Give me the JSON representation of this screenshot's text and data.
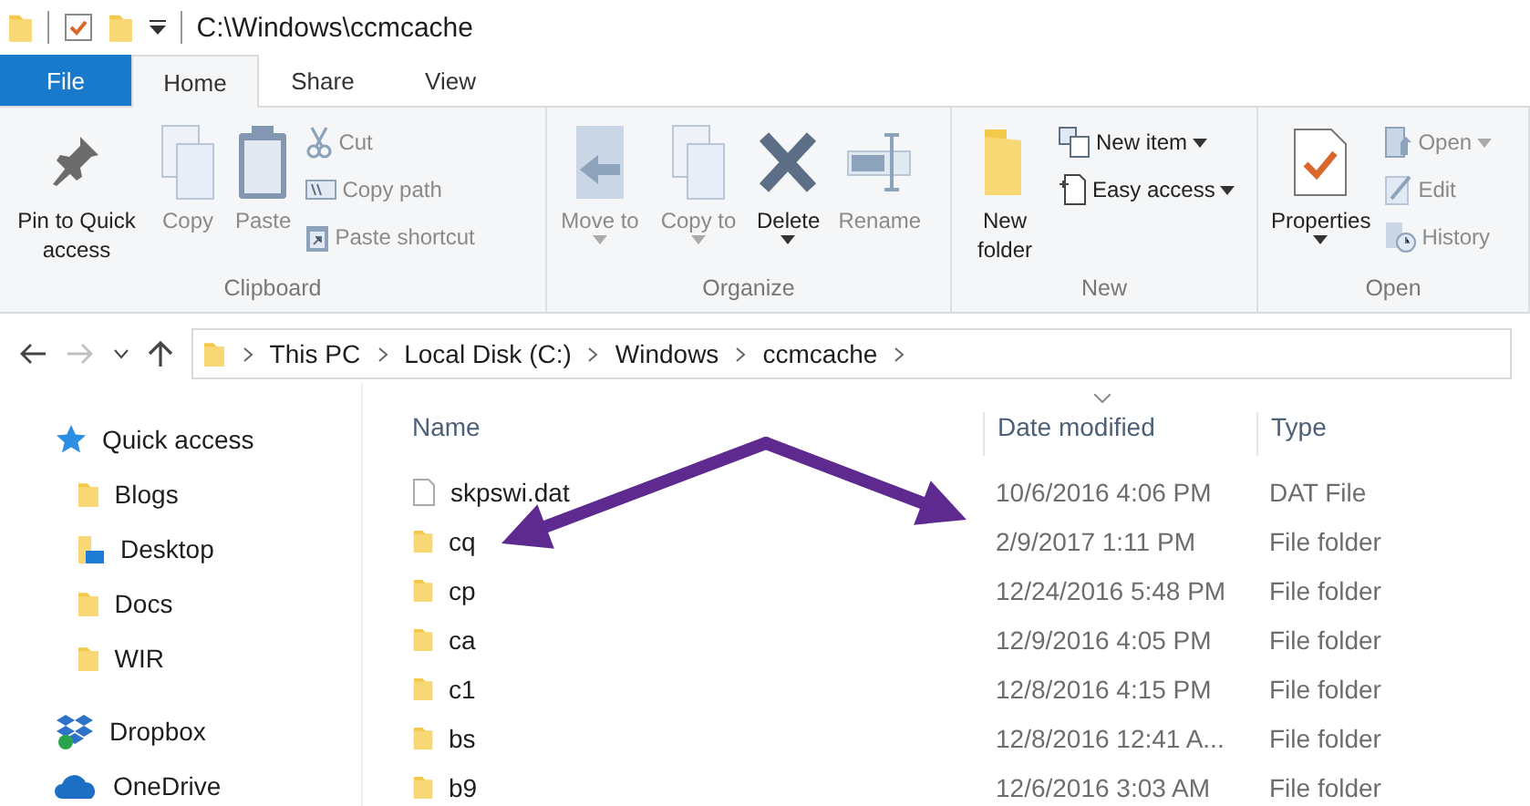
{
  "title_bar": {
    "path": "C:\\Windows\\ccmcache"
  },
  "tabs": [
    {
      "label": "File",
      "kind": "file",
      "selected": false
    },
    {
      "label": "Home",
      "kind": "tab",
      "selected": true
    },
    {
      "label": "Share",
      "kind": "tab",
      "selected": false
    },
    {
      "label": "View",
      "kind": "tab",
      "selected": false
    }
  ],
  "ribbon": [
    {
      "label": "Clipboard",
      "items": [
        {
          "label": "Pin to Quick access",
          "kind": "large",
          "disabled": false
        },
        {
          "label": "Copy",
          "kind": "large",
          "disabled": true
        },
        {
          "label": "Paste",
          "kind": "large",
          "disabled": true
        },
        {
          "label": "Cut",
          "kind": "small",
          "disabled": true
        },
        {
          "label": "Copy path",
          "kind": "small",
          "disabled": true
        },
        {
          "label": "Paste shortcut",
          "kind": "small",
          "disabled": true
        }
      ]
    },
    {
      "label": "Organize",
      "items": [
        {
          "label": "Move to",
          "kind": "large",
          "disabled": true,
          "dropdown": true
        },
        {
          "label": "Copy to",
          "kind": "large",
          "disabled": true,
          "dropdown": true
        },
        {
          "label": "Delete",
          "kind": "large",
          "disabled": false,
          "dropdown": true
        },
        {
          "label": "Rename",
          "kind": "large",
          "disabled": true
        }
      ]
    },
    {
      "label": "New",
      "items": [
        {
          "label": "New folder",
          "kind": "large",
          "disabled": false
        },
        {
          "label": "New item",
          "kind": "small",
          "disabled": false,
          "dropdown": true
        },
        {
          "label": "Easy access",
          "kind": "small",
          "disabled": false,
          "dropdown": true
        }
      ]
    },
    {
      "label": "Open",
      "items": [
        {
          "label": "Properties",
          "kind": "large",
          "disabled": false,
          "dropdown": true
        },
        {
          "label": "Open",
          "kind": "small",
          "disabled": true,
          "dropdown": true
        },
        {
          "label": "Edit",
          "kind": "small",
          "disabled": true
        },
        {
          "label": "History",
          "kind": "small",
          "disabled": true
        }
      ]
    }
  ],
  "navigation": {
    "back_disabled": false,
    "forward_disabled": true,
    "breadcrumb": [
      "This PC",
      "Local Disk (C:)",
      "Windows",
      "ccmcache"
    ]
  },
  "sidebar": [
    {
      "label": "Quick access",
      "kind": "star",
      "children": [
        {
          "label": "Blogs",
          "kind": "folder"
        },
        {
          "label": "Desktop",
          "kind": "desktop"
        },
        {
          "label": "Docs",
          "kind": "folder"
        },
        {
          "label": "WIR",
          "kind": "folder"
        }
      ]
    },
    {
      "label": "Dropbox",
      "kind": "dropbox"
    },
    {
      "label": "OneDrive",
      "kind": "cloud"
    }
  ],
  "table": {
    "columns": [
      {
        "label": "Name",
        "sorted": false
      },
      {
        "label": "Date modified",
        "sorted": true
      },
      {
        "label": "Type",
        "sorted": false
      }
    ],
    "rows": [
      {
        "name": "skpswi.dat",
        "date": "10/6/2016 4:06 PM",
        "type": "DAT File",
        "kind": "file"
      },
      {
        "name": "cq",
        "date": "2/9/2017 1:11 PM",
        "type": "File folder",
        "kind": "folder"
      },
      {
        "name": "cp",
        "date": "12/24/2016 5:48 PM",
        "type": "File folder",
        "kind": "folder"
      },
      {
        "name": "ca",
        "date": "12/9/2016 4:05 PM",
        "type": "File folder",
        "kind": "folder"
      },
      {
        "name": "c1",
        "date": "12/8/2016 4:15 PM",
        "type": "File folder",
        "kind": "folder"
      },
      {
        "name": "bs",
        "date": "12/8/2016 12:41 A...",
        "type": "File folder",
        "kind": "folder"
      },
      {
        "name": "b9",
        "date": "12/6/2016 3:03 AM",
        "type": "File folder",
        "kind": "folder"
      }
    ]
  }
}
